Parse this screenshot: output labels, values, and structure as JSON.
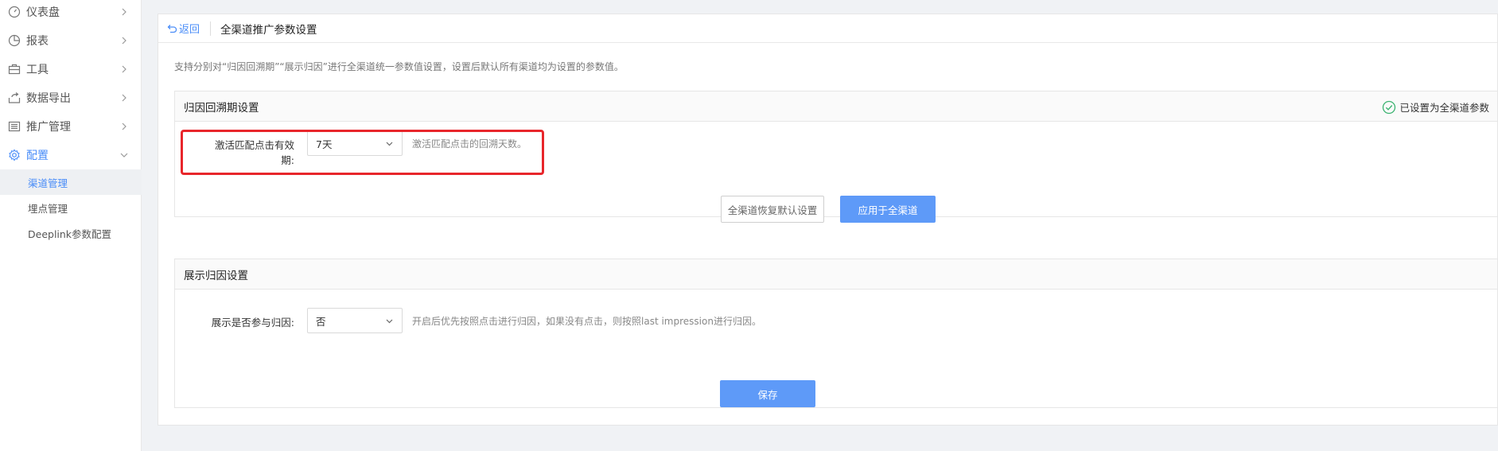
{
  "sidebar": {
    "items": [
      {
        "label": "仪表盘",
        "icon": "dashboard-icon"
      },
      {
        "label": "报表",
        "icon": "pie-chart-icon"
      },
      {
        "label": "工具",
        "icon": "briefcase-icon"
      },
      {
        "label": "数据导出",
        "icon": "export-icon"
      },
      {
        "label": "推广管理",
        "icon": "list-icon"
      },
      {
        "label": "配置",
        "icon": "gear-icon",
        "active": true
      }
    ],
    "sub_items": [
      {
        "label": "渠道管理",
        "selected": true
      },
      {
        "label": "埋点管理"
      },
      {
        "label": "Deeplink参数配置"
      }
    ]
  },
  "header": {
    "back_label": "返回",
    "title": "全渠道推广参数设置"
  },
  "description": "支持分别对“归因回溯期”“展示归因”进行全渠道统一参数值设置，设置后默认所有渠道均为设置的参数值。",
  "lookback_section": {
    "title": "归因回溯期设置",
    "status": "已设置为全渠道参数",
    "field_label": "激活匹配点击有效期:",
    "field_value": "7天",
    "field_hint": "激活匹配点击的回溯天数。",
    "reset_button": "全渠道恢复默认设置",
    "apply_button": "应用于全渠道"
  },
  "impression_section": {
    "title": "展示归因设置",
    "field_label": "展示是否参与归因:",
    "field_value": "否",
    "field_hint": "开启后优先按照点击进行归因，如果没有点击，则按照last impression进行归因。",
    "save_button": "保存"
  },
  "colors": {
    "accent": "#4a8df8",
    "primary_button": "#5e9af8",
    "highlight": "#e8262b",
    "success": "#3cb371"
  }
}
